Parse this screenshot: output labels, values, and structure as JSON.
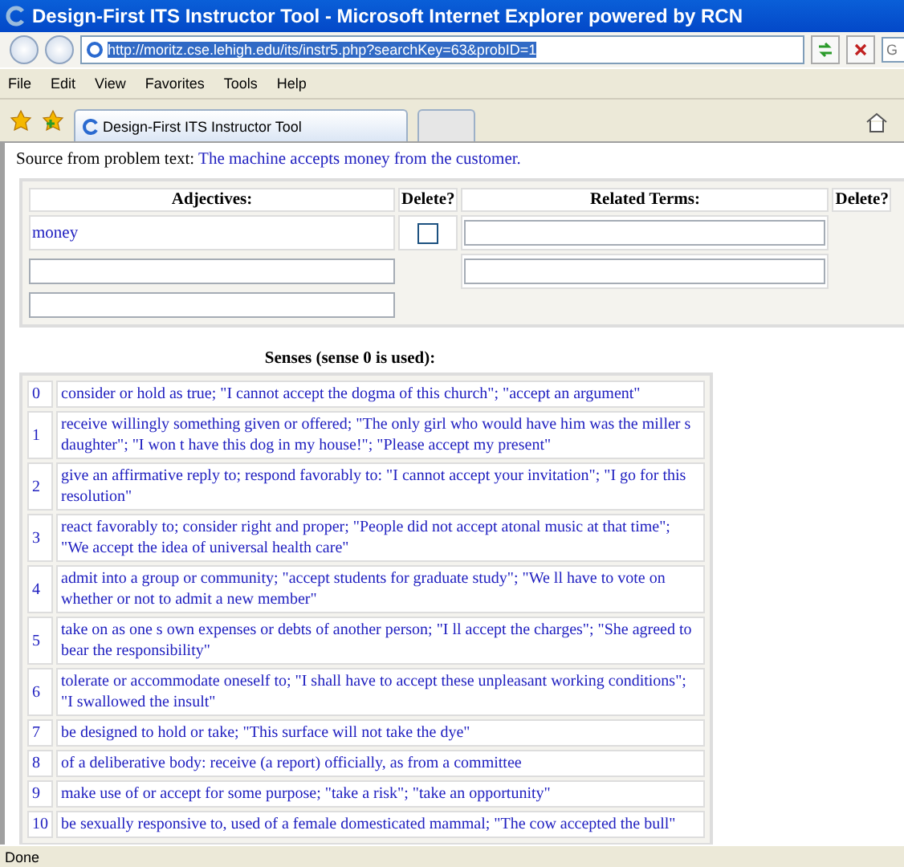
{
  "window": {
    "title": "Design-First ITS Instructor Tool - Microsoft Internet Explorer powered by RCN"
  },
  "address_bar": {
    "url": "http://moritz.cse.lehigh.edu/its/instr5.php?searchKey=63&probID=1"
  },
  "search": {
    "placeholder": "G"
  },
  "menu": [
    "File",
    "Edit",
    "View",
    "Favorites",
    "Tools",
    "Help"
  ],
  "tabs": [
    {
      "label": "Design-First ITS Instructor Tool",
      "selected": true
    },
    {
      "selected": false
    }
  ],
  "source": {
    "label": "Source from problem text:",
    "text": "The machine accepts money from the customer."
  },
  "table": {
    "columns": [
      "Adjectives:",
      "Delete?",
      "Related Terms:",
      "Delete?"
    ],
    "rows": [
      {
        "adjective": {
          "kind": "text",
          "text": "money"
        },
        "delete": {
          "checked": false
        },
        "related": {
          "kind": "field"
        }
      },
      {
        "adjective": {
          "kind": "field"
        },
        "related": {
          "kind": "field"
        }
      },
      {
        "adjective": {
          "kind": "field"
        }
      }
    ]
  },
  "senses": {
    "heading": "Senses (sense 0 is used):",
    "rows": [
      {
        "number": "0",
        "text": "consider or hold as true; \"I cannot accept the dogma of this church\"; \"accept an argument\""
      },
      {
        "number": "1",
        "text": "receive willingly something given or offered; \"The only girl who would have him was the miller s daughter\"; \"I won t have this dog in my house!\"; \"Please accept my present\""
      },
      {
        "number": "2",
        "text": "give an affirmative reply to; respond favorably to: \"I cannot accept your invitation\"; \"I go for this resolution\""
      },
      {
        "number": "3",
        "text": "react favorably to; consider right and proper; \"People did not accept atonal music at that time\"; \"We accept the idea of universal health care\""
      },
      {
        "number": "4",
        "text": "admit into a group or community; \"accept students for graduate study\"; \"We ll have to vote on whether or not to admit a new member\""
      },
      {
        "number": "5",
        "text": "take on as one s own expenses or debts of another person; \"I ll accept the charges\"; \"She agreed to bear the responsibility\""
      },
      {
        "number": "6",
        "text": "tolerate or accommodate oneself to; \"I shall have to accept these unpleasant working conditions\"; \"I swallowed the insult\""
      },
      {
        "number": "7",
        "text": "be designed to hold or take; \"This surface will not take the dye\""
      },
      {
        "number": "8",
        "text": "of a deliberative body: receive (a report) officially, as from a committee"
      },
      {
        "number": "9",
        "text": "make use of or accept for some purpose; \"take a risk\"; \"take an opportunity\""
      },
      {
        "number": "10",
        "text": "be sexually responsive to, used of a female domesticated mammal; \"The cow accepted the bull\""
      }
    ]
  },
  "status_bar": {
    "text": "Done"
  }
}
